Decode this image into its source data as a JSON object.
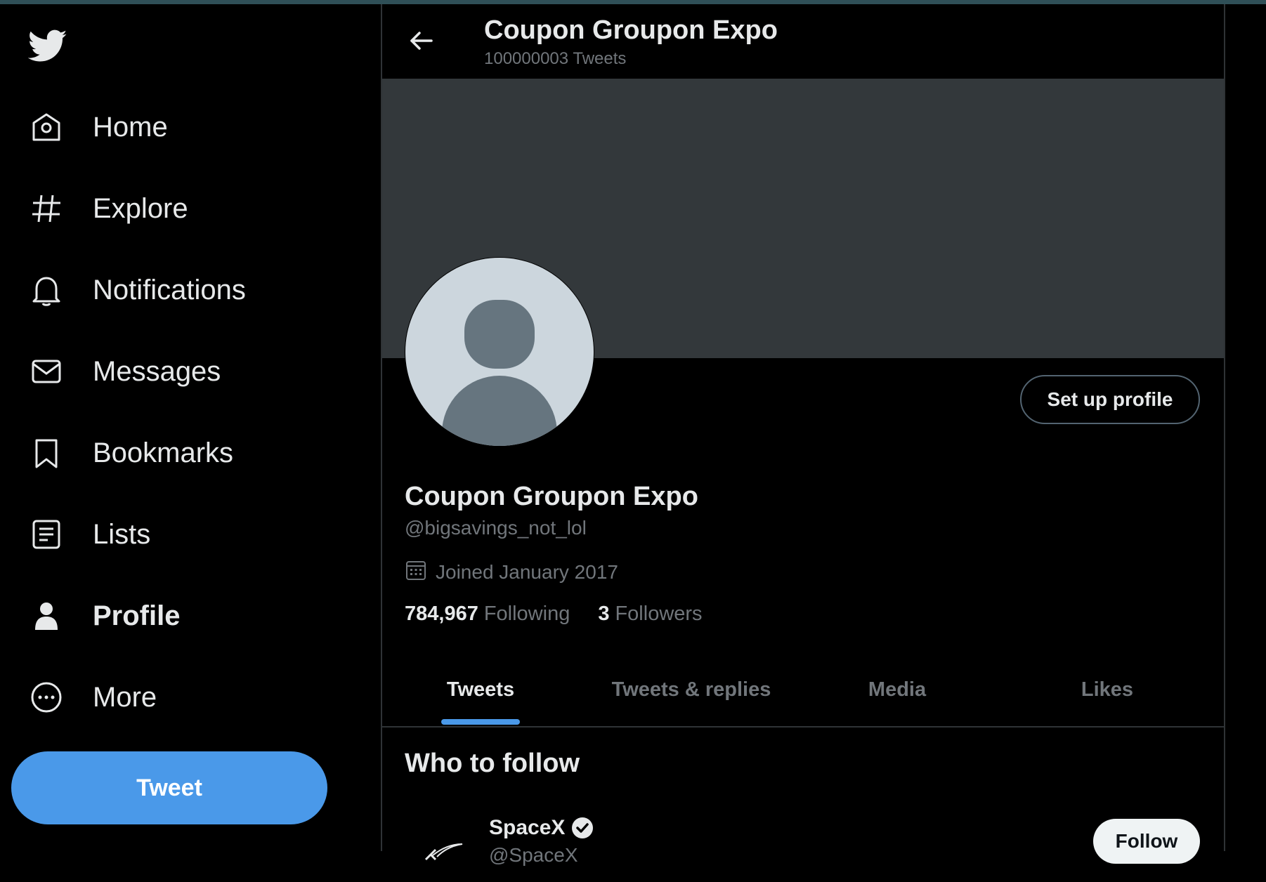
{
  "nav": {
    "items": [
      {
        "label": "Home",
        "icon": "home-icon"
      },
      {
        "label": "Explore",
        "icon": "hashtag-icon"
      },
      {
        "label": "Notifications",
        "icon": "bell-icon"
      },
      {
        "label": "Messages",
        "icon": "envelope-icon"
      },
      {
        "label": "Bookmarks",
        "icon": "bookmark-icon"
      },
      {
        "label": "Lists",
        "icon": "list-icon"
      },
      {
        "label": "Profile",
        "icon": "person-icon",
        "active": true
      },
      {
        "label": "More",
        "icon": "more-circle-icon"
      }
    ],
    "tweet_label": "Tweet"
  },
  "header": {
    "title": "Coupon Groupon Expo",
    "tweet_count": "100000003 Tweets"
  },
  "profile": {
    "name": "Coupon Groupon Expo",
    "handle": "@bigsavings_not_lol",
    "joined": "Joined January 2017",
    "following_count": "784,967",
    "following_label": "Following",
    "followers_count": "3",
    "followers_label": "Followers",
    "setup_label": "Set up profile"
  },
  "tabs": [
    {
      "label": "Tweets",
      "active": true
    },
    {
      "label": "Tweets & replies"
    },
    {
      "label": "Media"
    },
    {
      "label": "Likes"
    }
  ],
  "who_to_follow": {
    "title": "Who to follow",
    "suggestions": [
      {
        "name": "SpaceX",
        "handle": "@SpaceX",
        "verified": true,
        "button": "Follow"
      }
    ]
  },
  "colors": {
    "accent": "#4a99e9",
    "background": "#000000",
    "banner": "#33383b",
    "muted_text": "#71767b"
  }
}
